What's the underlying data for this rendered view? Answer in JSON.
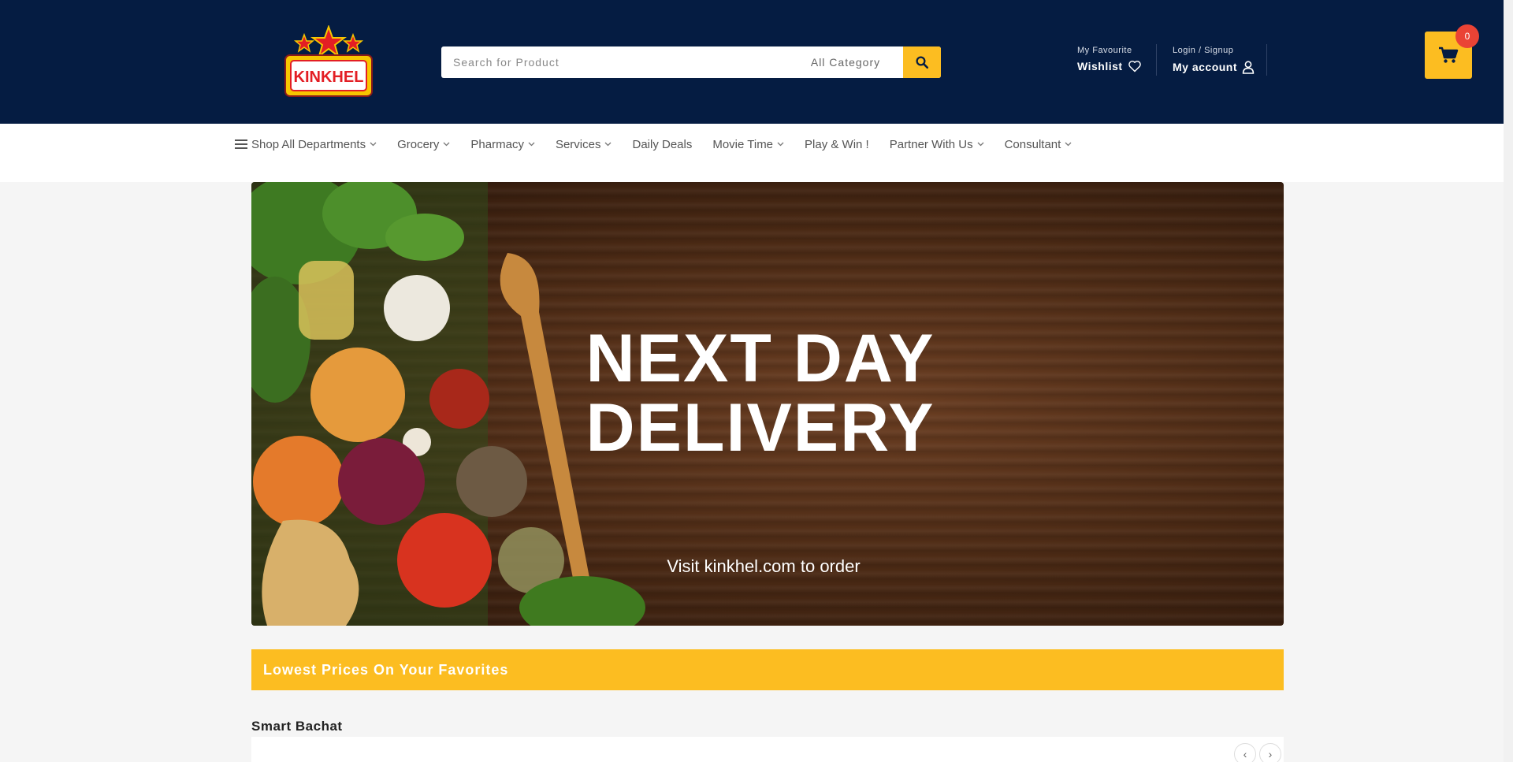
{
  "header": {
    "logo_text": "KINKHEL",
    "search": {
      "placeholder": "Search for Product",
      "category": "All Category"
    },
    "wishlist": {
      "small": "My Favourite",
      "label": "Wishlist"
    },
    "account": {
      "small": "Login / Signup",
      "label": "My account"
    },
    "cart": {
      "count": "0"
    },
    "colors": {
      "navy": "#051c42",
      "accent": "#fcbd21",
      "badge": "#ea4335"
    }
  },
  "nav": {
    "items": [
      {
        "label": "Shop All Departments",
        "dropdown": true,
        "icon": "menu-icon"
      },
      {
        "label": "Grocery",
        "dropdown": true
      },
      {
        "label": "Pharmacy",
        "dropdown": true
      },
      {
        "label": "Services",
        "dropdown": true
      },
      {
        "label": "Daily Deals",
        "dropdown": false
      },
      {
        "label": "Movie Time",
        "dropdown": true
      },
      {
        "label": "Play & Win !",
        "dropdown": false
      },
      {
        "label": "Partner With Us",
        "dropdown": true
      },
      {
        "label": "Consultant",
        "dropdown": true
      }
    ]
  },
  "hero": {
    "title_line1": "NEXT DAY",
    "title_line2": "DELIVERY",
    "subtitle": "Visit kinkhel.com  to order"
  },
  "banner": {
    "label": "Lowest Prices On Your Favorites"
  },
  "section": {
    "title": "Smart Bachat",
    "prev": "‹",
    "next": "›"
  }
}
